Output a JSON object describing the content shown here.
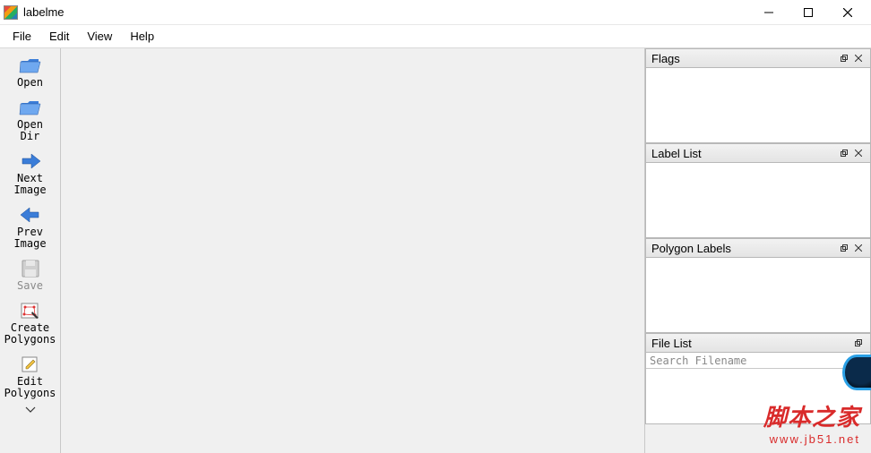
{
  "window": {
    "title": "labelme"
  },
  "menu": {
    "file": "File",
    "edit": "Edit",
    "view": "View",
    "help": "Help"
  },
  "toolbar": {
    "open": "Open",
    "open_dir_l1": "Open",
    "open_dir_l2": "Dir",
    "next_l1": "Next",
    "next_l2": "Image",
    "prev_l1": "Prev",
    "prev_l2": "Image",
    "save": "Save",
    "create_l1": "Create",
    "create_l2": "Polygons",
    "edit_l1": "Edit",
    "edit_l2": "Polygons"
  },
  "panels": {
    "flags": "Flags",
    "label_list": "Label List",
    "polygon_labels": "Polygon Labels",
    "file_list": "File List",
    "search_placeholder": "Search Filename"
  },
  "watermark": {
    "line1": "脚本之家",
    "line2": "www.jb51.net"
  }
}
